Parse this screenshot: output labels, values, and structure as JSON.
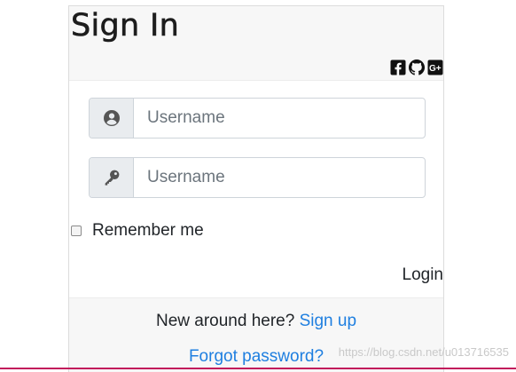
{
  "header": {
    "title": "Sign In"
  },
  "social": {
    "icons": [
      "facebook-icon",
      "github-icon",
      "google-plus-icon"
    ]
  },
  "form": {
    "username": {
      "placeholder": "Username",
      "value": ""
    },
    "password": {
      "placeholder": "Username",
      "value": ""
    },
    "remember_label": "Remember me",
    "remember_checked": false,
    "login_label": "Login"
  },
  "footer": {
    "new_here_text": "New around here?",
    "signup_link": "Sign up",
    "forgot_link": "Forgot password?"
  },
  "watermark": "https://blog.csdn.net/u013716535",
  "colors": {
    "link": "#1f7fe0",
    "header_bg": "#f7f7f7",
    "addon_bg": "#e9ecef",
    "bottom_rule": "#c2185b"
  }
}
